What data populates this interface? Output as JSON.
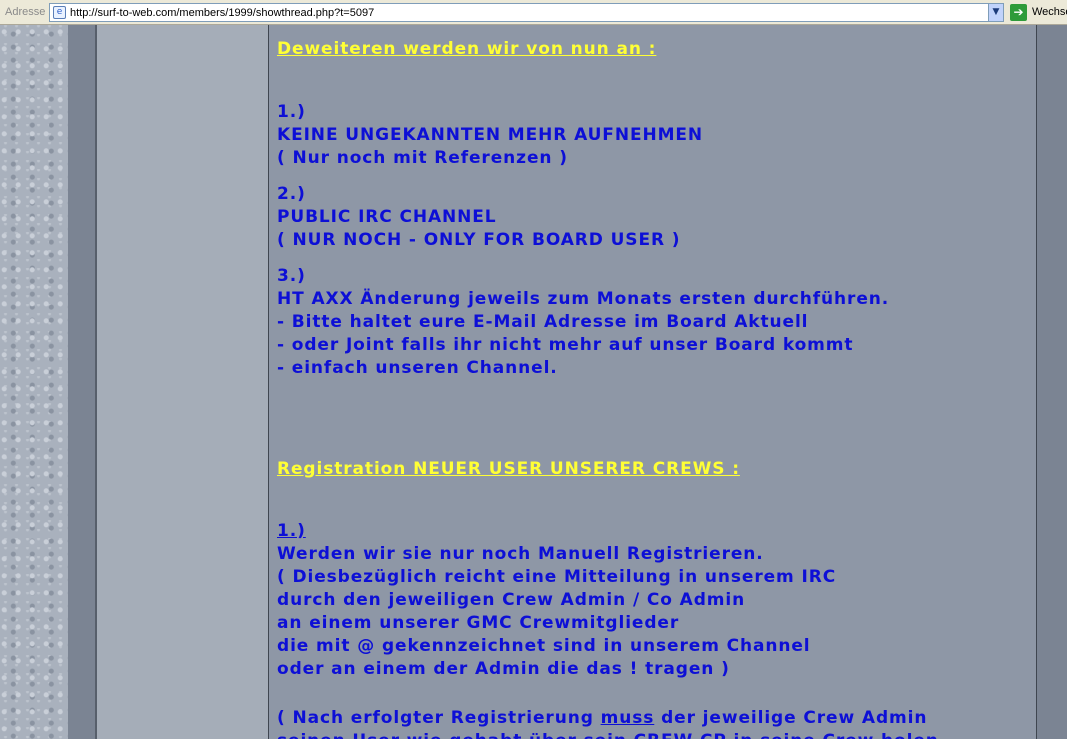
{
  "browser": {
    "address_label": "Adresse",
    "url": "http://surf-to-web.com/members/1999/showthread.php?t=5097",
    "go_label": "Wechse"
  },
  "post": {
    "heading1": "Deweiteren werden wir von nun an :",
    "items": [
      {
        "num": "1.)",
        "lines": [
          "KEINE UNGEKANNTEN MEHR AUFNEHMEN",
          "( Nur noch mit Referenzen )"
        ]
      },
      {
        "num": "2.)",
        "lines": [
          "PUBLIC IRC CHANNEL",
          "( NUR NOCH - ONLY FOR BOARD USER )"
        ]
      },
      {
        "num": "3.)",
        "lines": [
          "HT AXX Änderung jeweils zum Monats ersten durchführen.",
          "- Bitte haltet eure E-Mail Adresse im Board Aktuell",
          "- oder Joint falls ihr nicht mehr auf unser Board kommt",
          "- einfach unseren Channel."
        ]
      }
    ],
    "heading2": "Registration NEUER USER UNSERER CREWS :",
    "reg_num": "1.)",
    "reg_lines": [
      "Werden wir sie nur noch Manuell Registrieren.",
      "( Diesbezüglich reicht eine Mitteilung in unserem IRC",
      "durch den jeweiligen Crew Admin / Co Admin",
      "an einem unserer GMC Crewmitglieder",
      "die mit @ gekennzeichnet sind in unserem Channel",
      "oder an einem der Admin die das ! tragen )"
    ],
    "last_line": {
      "before": "( Nach erfolgter Registrierung ",
      "emph": "muss",
      "after": " der jeweilige Crew Admin"
    },
    "cut_line": "seinen User wie gehabt über sein CREW CP in seine Crew holen"
  },
  "colors": {
    "body_text": "#0d0fd6",
    "heading": "#ffff35",
    "main_bg": "#8e97a6",
    "sidebar_bg": "#a5adb8"
  }
}
